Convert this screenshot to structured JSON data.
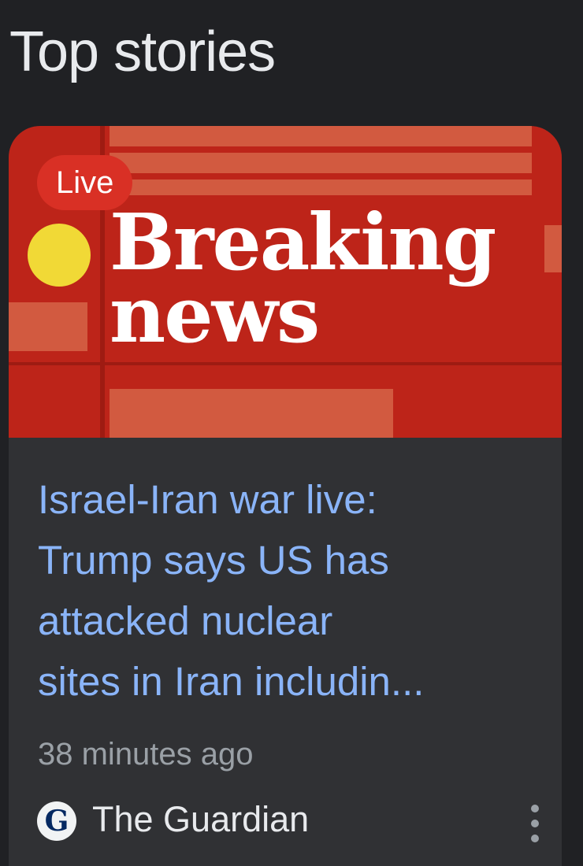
{
  "section": {
    "title": "Top stories"
  },
  "story": {
    "thumbnail": {
      "badge": "Live",
      "line1": "Breaking",
      "line2": "news",
      "accent_color": "#bd2419"
    },
    "headline_lines": [
      "Israel-Iran war live:",
      "Trump says US has",
      "attacked nuclear",
      "sites in Iran includin..."
    ],
    "timestamp": "38 minutes ago",
    "source": {
      "logo_letter": "G",
      "name": "The Guardian"
    },
    "more_icon": "more-vert-icon"
  },
  "colors": {
    "background": "#202124",
    "card": "#303134",
    "headline": "#8ab4f8",
    "live_badge": "#d93025"
  }
}
